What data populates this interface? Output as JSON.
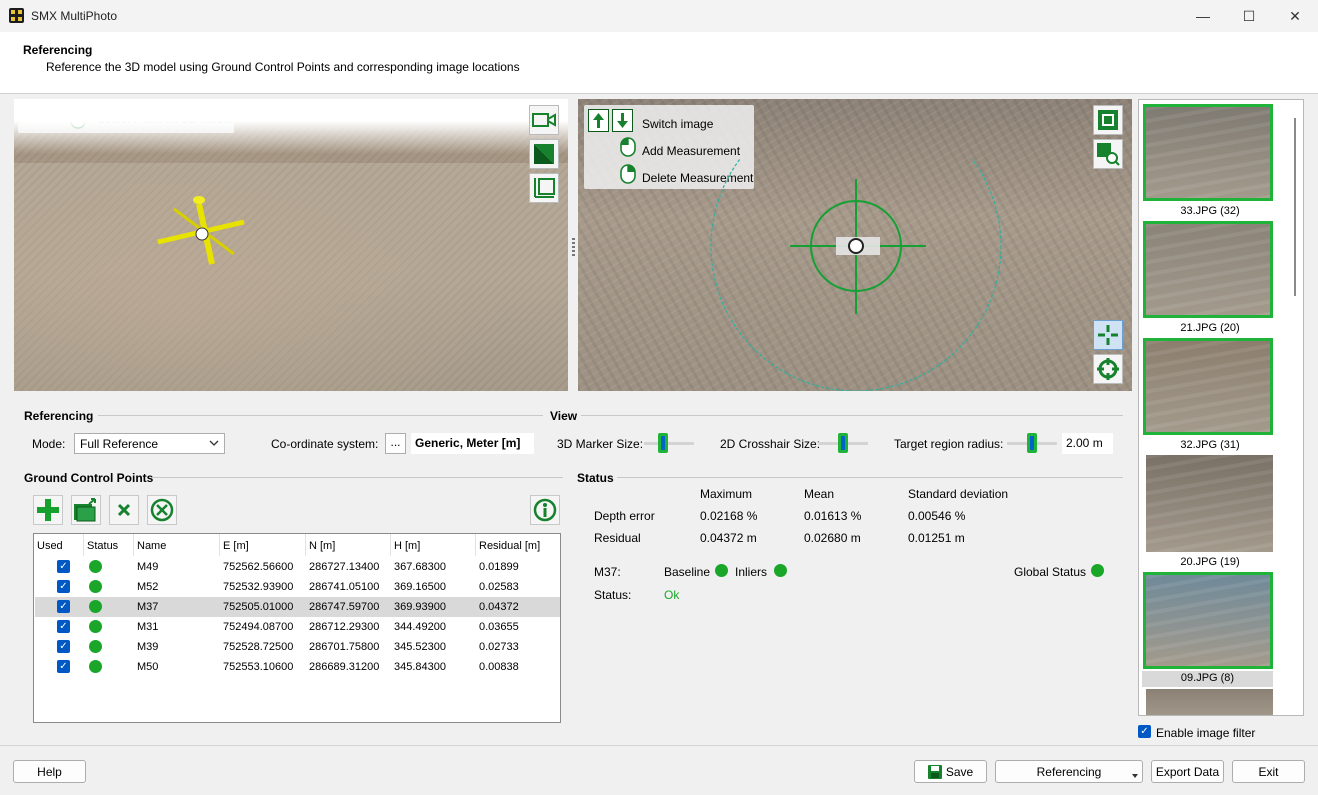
{
  "window": {
    "title": "SMX MultiPhoto"
  },
  "header": {
    "title": "Referencing",
    "subtitle": "Reference the 3D model using Ground Control Points and corresponding image locations"
  },
  "view3d": {
    "hint": "Select Point on 3D Model"
  },
  "view2d": {
    "switch_label": "Switch image",
    "add_label": "Add Measurement",
    "delete_label": "Delete Measurement"
  },
  "referencing": {
    "section": "Referencing",
    "mode_label": "Mode:",
    "mode_value": "Full Reference",
    "coord_label": "Co-ordinate system:",
    "coord_btn": "...",
    "coord_value": "Generic, Meter [m]"
  },
  "view": {
    "section": "View",
    "marker_label": "3D Marker Size:",
    "crosshair_label": "2D Crosshair Size:",
    "target_label": "Target region radius:",
    "target_value": "2.00 m",
    "marker_level": 0.35,
    "crosshair_level": 0.5,
    "target_level": 0.5
  },
  "gcp": {
    "section": "Ground Control Points",
    "columns": [
      "Used",
      "Status",
      "Name",
      "E [m]",
      "N [m]",
      "H [m]",
      "Residual [m]"
    ],
    "rows": [
      {
        "name": "M49",
        "e": "752562.56600",
        "n": "286727.13400",
        "h": "367.68300",
        "r": "0.01899"
      },
      {
        "name": "M52",
        "e": "752532.93900",
        "n": "286741.05100",
        "h": "369.16500",
        "r": "0.02583"
      },
      {
        "name": "M37",
        "e": "752505.01000",
        "n": "286747.59700",
        "h": "369.93900",
        "r": "0.04372"
      },
      {
        "name": "M31",
        "e": "752494.08700",
        "n": "286712.29300",
        "h": "344.49200",
        "r": "0.03655"
      },
      {
        "name": "M39",
        "e": "752528.72500",
        "n": "286701.75800",
        "h": "345.52300",
        "r": "0.02733"
      },
      {
        "name": "M50",
        "e": "752553.10600",
        "n": "286689.31200",
        "h": "345.84300",
        "r": "0.00838"
      }
    ]
  },
  "status": {
    "section": "Status",
    "col_max": "Maximum",
    "col_mean": "Mean",
    "col_std": "Standard deviation",
    "depth_label": "Depth error",
    "depth_max": "0.02168 %",
    "depth_mean": "0.01613 %",
    "depth_std": "0.00546 %",
    "res_label": "Residual",
    "res_max": "0.04372 m",
    "res_mean": "0.02680 m",
    "res_std": "0.01251 m",
    "point": "M37:",
    "baseline": "Baseline",
    "inliers": "Inliers",
    "global": "Global Status",
    "status_label": "Status:",
    "status_value": "Ok"
  },
  "thumbs": [
    "33.JPG (32)",
    "21.JPG (20)",
    "32.JPG (31)",
    "20.JPG (19)",
    "09.JPG (8)"
  ],
  "filter_label": "Enable image filter",
  "buttons": {
    "help": "Help",
    "save": "Save",
    "referencing": "Referencing",
    "export": "Export Data",
    "exit": "Exit"
  },
  "colors": {
    "accent": "#0058c4",
    "ok": "#19a629",
    "thumb_border": "#1fb33a"
  }
}
